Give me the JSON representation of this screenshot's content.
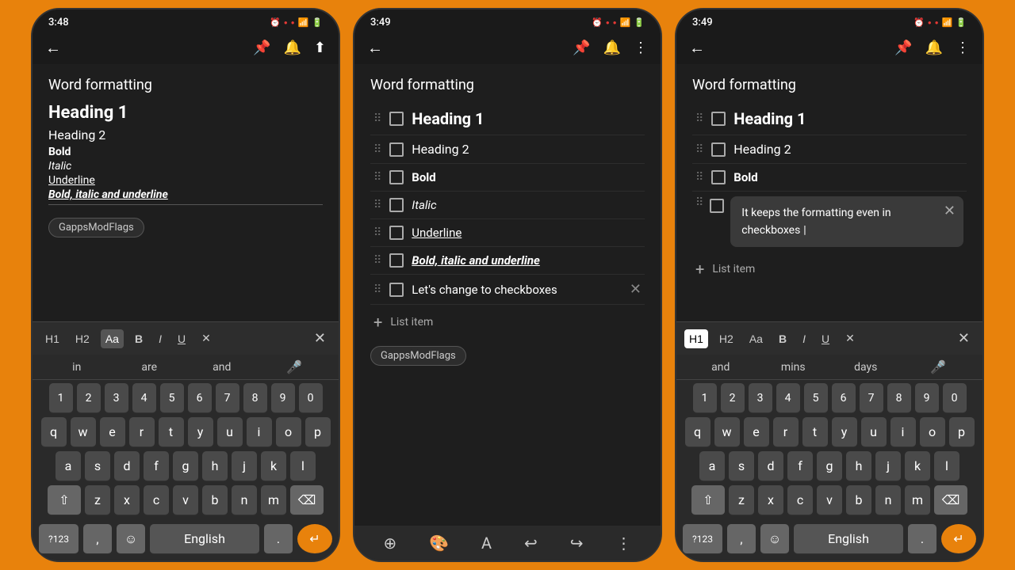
{
  "phones": [
    {
      "id": "phone1",
      "status_time": "3:48",
      "doc_title": "Word formatting",
      "heading1": "Heading 1",
      "heading2": "Heading 2",
      "bold": "Bold",
      "italic": "Italic",
      "underline": "Underline",
      "bold_italic_underline": "Bold, italic and underline",
      "tag": "GappsModFlags",
      "suggestions": [
        "in",
        "are",
        "and"
      ],
      "keys_numbers": [
        "1",
        "2",
        "3",
        "4",
        "5",
        "6",
        "7",
        "8",
        "9",
        "0"
      ],
      "keys_row1": [
        "q",
        "w",
        "e",
        "r",
        "t",
        "y",
        "u",
        "i",
        "o",
        "p"
      ],
      "keys_row2": [
        "a",
        "s",
        "d",
        "f",
        "g",
        "h",
        "j",
        "k",
        "l"
      ],
      "keys_row3": [
        "z",
        "x",
        "c",
        "v",
        "b",
        "n",
        "m"
      ],
      "special_key": "?123",
      "language": "English",
      "format_btns": [
        "H1",
        "H2",
        "Aa",
        "B",
        "I",
        "U",
        "✕"
      ]
    },
    {
      "id": "phone2",
      "status_time": "3:49",
      "doc_title": "Word formatting",
      "items": [
        {
          "text": "Heading 1",
          "style": "heading1"
        },
        {
          "text": "Heading 2",
          "style": "heading2"
        },
        {
          "text": "Bold",
          "style": "bold"
        },
        {
          "text": "Italic",
          "style": "italic"
        },
        {
          "text": "Underline",
          "style": "underline"
        },
        {
          "text": "Bold, italic and underline",
          "style": "bold-italic-underline"
        },
        {
          "text": "Let's change to checkboxes",
          "style": "normal",
          "has_delete": true
        }
      ],
      "add_item_label": "List item",
      "tag": "GappsModFlags"
    },
    {
      "id": "phone3",
      "status_time": "3:49",
      "doc_title": "Word formatting",
      "items": [
        {
          "text": "Heading 1",
          "style": "heading1"
        },
        {
          "text": "Heading 2",
          "style": "heading2"
        },
        {
          "text": "Bold",
          "style": "bold"
        }
      ],
      "tooltip_text": "It keeps the formatting even in checkboxes",
      "add_item_label": "List item",
      "suggestions": [
        "and",
        "mins",
        "days"
      ],
      "keys_numbers": [
        "1",
        "2",
        "3",
        "4",
        "5",
        "6",
        "7",
        "8",
        "9",
        "0"
      ],
      "keys_row1": [
        "q",
        "w",
        "e",
        "r",
        "t",
        "y",
        "u",
        "i",
        "o",
        "p"
      ],
      "keys_row2": [
        "a",
        "s",
        "d",
        "f",
        "g",
        "h",
        "j",
        "k",
        "l"
      ],
      "keys_row3": [
        "z",
        "x",
        "c",
        "v",
        "b",
        "n",
        "m"
      ],
      "special_key": "?123",
      "language": "English",
      "format_btns": [
        "H1",
        "H2",
        "Aa",
        "B",
        "I",
        "U",
        "✕"
      ]
    }
  ]
}
